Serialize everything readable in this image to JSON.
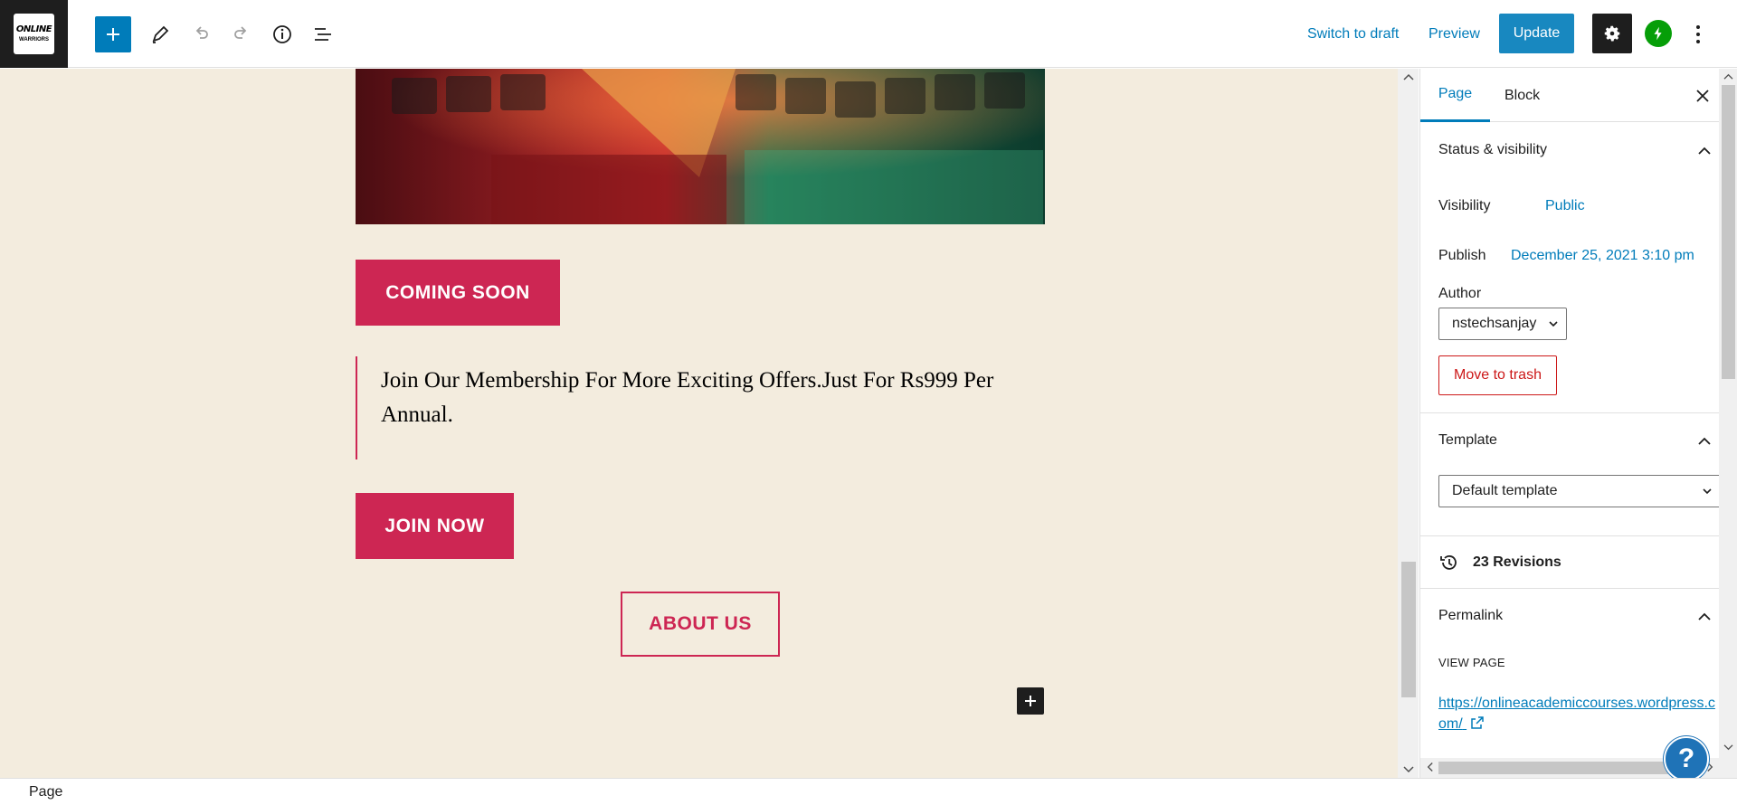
{
  "logo": {
    "line1": "ONLINE",
    "line2": "WARRIORS"
  },
  "toolbar": {
    "add_block_icon": "plus-icon",
    "tools_icon": "pencil-icon",
    "undo_icon": "undo-icon",
    "redo_icon": "redo-icon",
    "details_icon": "info-icon",
    "list_view_icon": "list-view-icon",
    "switch_to_draft": "Switch to draft",
    "preview": "Preview",
    "update": "Update",
    "settings_icon": "gear-icon",
    "jetpack_icon": "jetpack-icon",
    "more_icon": "more-vertical-icon"
  },
  "canvas": {
    "coming_soon": "COMING SOON",
    "quote_text": "Join Our Membership For More Exciting Offers.Just For Rs999 Per Annual.",
    "join_now": "JOIN NOW",
    "about_us": "ABOUT US"
  },
  "sidebar": {
    "tabs": {
      "page": "Page",
      "block": "Block"
    },
    "status_visibility": {
      "title": "Status & visibility",
      "visibility_label": "Visibility",
      "visibility_value": "Public",
      "publish_label": "Publish",
      "publish_value": "December 25, 2021 3:10 pm",
      "author_label": "Author",
      "author_value": "nstechsanjay",
      "move_to_trash": "Move to trash"
    },
    "template": {
      "title": "Template",
      "value": "Default template"
    },
    "revisions": "23 Revisions",
    "permalink": {
      "title": "Permalink",
      "view_page": "VIEW PAGE",
      "url": "https://onlineacademiccourses.wordpress.com/"
    }
  },
  "help_label": "?",
  "footer": {
    "breadcrumb": "Page"
  },
  "colors": {
    "accent": "#007cba",
    "brand_button": "#cd2653",
    "canvas_bg": "#f3ecde",
    "trash": "#cc1818"
  }
}
